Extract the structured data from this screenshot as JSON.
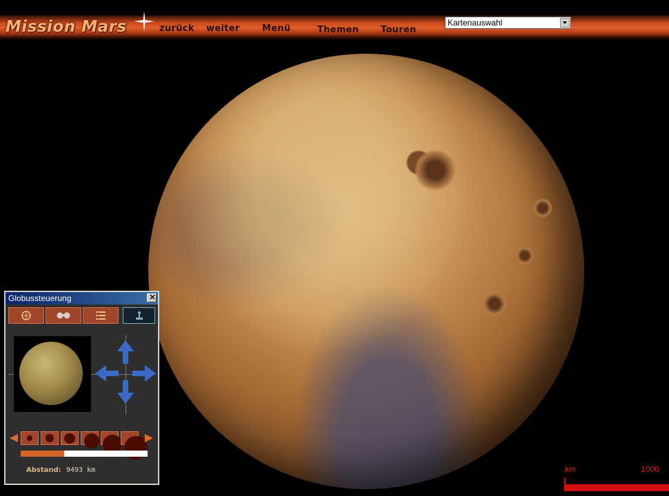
{
  "app": {
    "logo": "Mission Mars"
  },
  "nav": {
    "back": "zurück",
    "forward": "weiter",
    "menu": "Menü",
    "themes": "Themen",
    "tours": "Touren"
  },
  "map_select": {
    "value": "Kartenauswahl"
  },
  "panel": {
    "title": "Globussteuerung",
    "tabs": [
      "globe-icon",
      "binoculars-icon",
      "list-icon",
      "joystick-icon"
    ],
    "active_tab": 3,
    "zoom_level_fraction": 0.34,
    "distance_label": "Abstand:",
    "distance_value": "9493 km"
  },
  "scale": {
    "unit": "km",
    "value": "1000"
  },
  "colors": {
    "accent": "#c8481a",
    "panel_button": "#a0462a",
    "scale": "#d01010"
  }
}
